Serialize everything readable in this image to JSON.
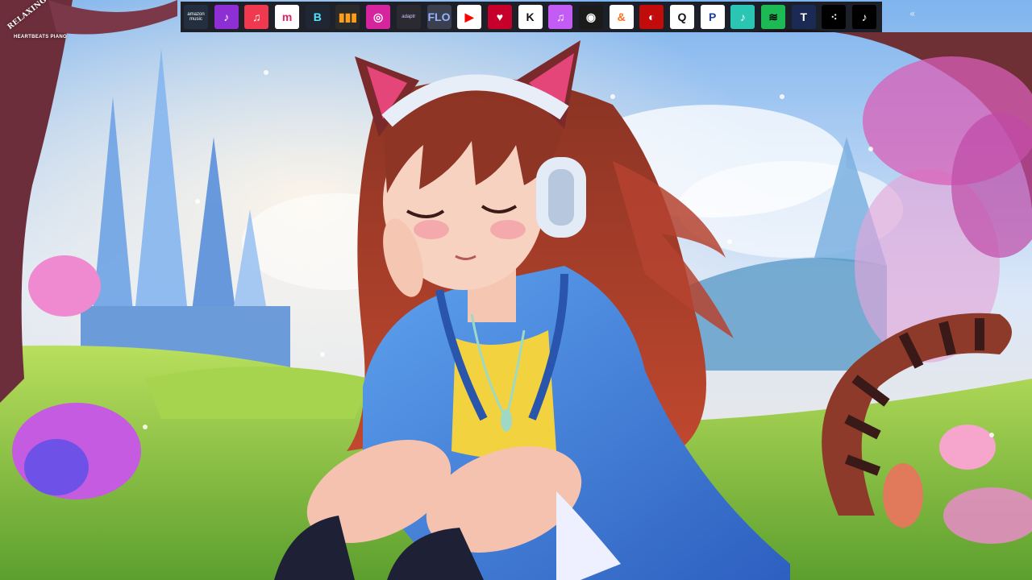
{
  "scene": {
    "description_icon": "anime-girl-cat-ears-headphones-illustration",
    "colors": {
      "sky": "#9fc6ef",
      "hoodie": "#3b78d4",
      "hair": "#7a2a2a",
      "grass": "#8fc94e",
      "shirt": "#f2d33f"
    }
  },
  "logo": {
    "line1": "RELAXING",
    "line2": "HEARTBEATS PIANO"
  },
  "toolbar": {
    "services": [
      {
        "name": "amazon-music",
        "label": "amazon\nmusic",
        "bg": "#232f3e",
        "fg": "#ffffff"
      },
      {
        "name": "pandora-like",
        "label": "♪",
        "bg": "#8e2fd6",
        "fg": "#ffffff"
      },
      {
        "name": "apple-music",
        "label": "♫",
        "bg": "#f0394e",
        "fg": "#ffffff"
      },
      {
        "name": "melon-m",
        "label": "m",
        "bg": "#ffffff",
        "fg": "#e0245e"
      },
      {
        "name": "beatport",
        "label": "B",
        "bg": "#1e2733",
        "fg": "#55e3ff"
      },
      {
        "name": "deezer",
        "label": "▮▮▮",
        "bg": "#2b2b2b",
        "fg": "#ff9e1b"
      },
      {
        "name": "instagram",
        "label": "◎",
        "bg": "#d6249f",
        "fg": "#ffffff"
      },
      {
        "name": "adaptr",
        "label": "adaptr",
        "bg": "#2a2a30",
        "fg": "#d7c7ff"
      },
      {
        "name": "flo",
        "label": "FLO",
        "bg": "#3a4050",
        "fg": "#9ab3ff"
      },
      {
        "name": "youtube-music",
        "label": "▶",
        "bg": "#ffffff",
        "fg": "#ff0000"
      },
      {
        "name": "iheartradio",
        "label": "♥",
        "bg": "#c6002b",
        "fg": "#ffffff"
      },
      {
        "name": "kkbox",
        "label": "K",
        "bg": "#ffffff",
        "fg": "#111111"
      },
      {
        "name": "itunes",
        "label": "♫",
        "bg": "#c35cf5",
        "fg": "#ffffff"
      },
      {
        "name": "napster",
        "label": "◉",
        "bg": "#1b1b1b",
        "fg": "#ffffff"
      },
      {
        "name": "anghami",
        "label": "&",
        "bg": "#ffffff",
        "fg": "#ff6b1a"
      },
      {
        "name": "netease",
        "label": "◐",
        "bg": "#c20c0c",
        "fg": "#ffffff"
      },
      {
        "name": "qobuz",
        "label": "Q",
        "bg": "#ffffff",
        "fg": "#111111"
      },
      {
        "name": "pandora",
        "label": "P",
        "bg": "#ffffff",
        "fg": "#224099"
      },
      {
        "name": "jiosaavn",
        "label": "♪",
        "bg": "#2bc5b4",
        "fg": "#ffffff"
      },
      {
        "name": "spotify",
        "label": "≋",
        "bg": "#1db954",
        "fg": "#000000"
      },
      {
        "name": "tidal-alt",
        "label": "T",
        "bg": "#1a2a55",
        "fg": "#ffffff"
      },
      {
        "name": "tidal",
        "label": "⁖",
        "bg": "#000000",
        "fg": "#ffffff"
      },
      {
        "name": "tiktok",
        "label": "♪",
        "bg": "#000000",
        "fg": "#ffffff"
      }
    ],
    "more_glyph": "«"
  }
}
